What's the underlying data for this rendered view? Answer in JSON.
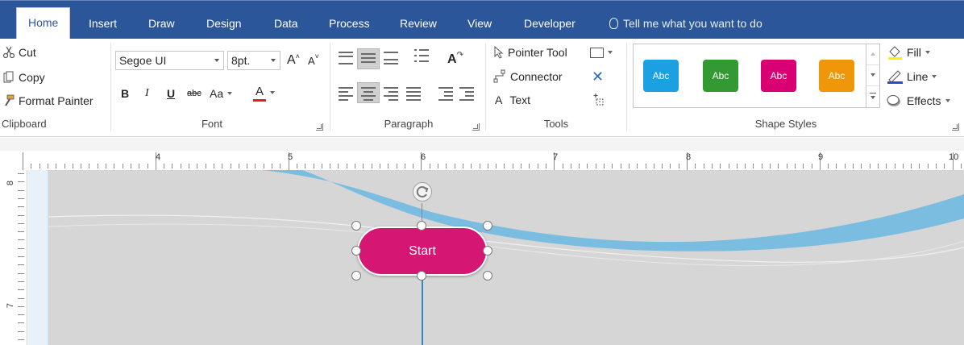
{
  "tabs": [
    {
      "label": "Home",
      "active": true
    },
    {
      "label": "Insert"
    },
    {
      "label": "Draw"
    },
    {
      "label": "Design"
    },
    {
      "label": "Data"
    },
    {
      "label": "Process"
    },
    {
      "label": "Review"
    },
    {
      "label": "View"
    },
    {
      "label": "Developer"
    }
  ],
  "tell_me": "Tell me what you want to do",
  "clipboard": {
    "cut": "Cut",
    "copy": "Copy",
    "format_painter": "Format Painter",
    "group_label": "Clipboard"
  },
  "font": {
    "family": "Segoe UI",
    "size": "8pt.",
    "grow": "A",
    "shrink": "A",
    "bold": "B",
    "italic": "I",
    "underline": "U",
    "strike": "abc",
    "case": "Aa",
    "color_letter": "A",
    "group_label": "Font"
  },
  "paragraph": {
    "group_label": "Paragraph",
    "text_block": "A"
  },
  "tools": {
    "pointer": "Pointer Tool",
    "connector": "Connector",
    "text": "Text",
    "text_icon": "A",
    "group_label": "Tools"
  },
  "shape_styles": {
    "group_label": "Shape Styles",
    "swatches": [
      {
        "label": "Abc",
        "color": "#1ba1e2"
      },
      {
        "label": "Abc",
        "color": "#339933"
      },
      {
        "label": "Abc",
        "color": "#d80073"
      },
      {
        "label": "Abc",
        "color": "#f09609"
      }
    ],
    "fill": "Fill",
    "line": "Line",
    "effects": "Effects"
  },
  "ruler": {
    "h_numbers": [
      "4",
      "5",
      "6",
      "7",
      "8",
      "9",
      "10"
    ],
    "v_numbers": [
      "8",
      "7"
    ]
  },
  "canvas": {
    "shape_text": "Start",
    "shape_color": "#d51673",
    "connector_color": "#2e88c7",
    "wave_color": "#7bbde0"
  }
}
